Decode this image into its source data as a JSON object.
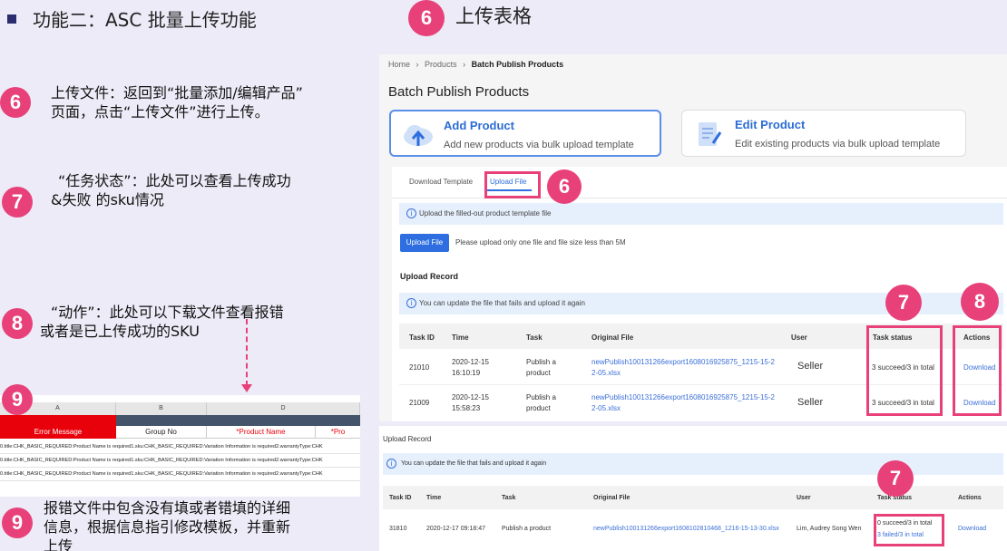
{
  "left": {
    "heading": "功能二：ASC 批量上传功能",
    "steps": [
      {
        "num": "6",
        "text_line1": "上传文件：返回到“批量添加/编辑产品”",
        "text_line2": "页面，点击“上传文件”进行上传。"
      },
      {
        "num": "7",
        "text_line1": "“任务状态”：此处可以查看上传成功",
        "text_line2": "&失败 的sku情况"
      },
      {
        "num": "8",
        "text_line1": "“动作”：此处可以下载文件查看报错",
        "text_line2": "或者是已上传成功的SKU"
      },
      {
        "num": "9",
        "text_line1": "报错文件中包含没有填或者错填的详细",
        "text_line2": "信息，根据信息指引修改模板，并重新",
        "text_line3": "上传"
      }
    ],
    "excel": {
      "badge": "9",
      "columns": [
        "A",
        "B",
        "D"
      ],
      "headers": [
        "Error Message",
        "Group No",
        "*Product Name",
        "*Pro"
      ],
      "rows": [
        "0.title:CHK_BASIC_REQUIRED:Product Name is required1.sku:CHK_BASIC_REQUIRED:Variation Information is required2.warrantyType:CHK",
        "0.title:CHK_BASIC_REQUIRED:Product Name is required1.sku:CHK_BASIC_REQUIRED:Variation Information is required2.warrantyType:CHK",
        "0.title:CHK_BASIC_REQUIRED:Product Name is required1.sku:CHK_BASIC_REQUIRED:Variation Information is required2.warrantyType:CHK"
      ],
      "accent": "#e8000b"
    }
  },
  "top": {
    "badge": "6",
    "title": "上传表格"
  },
  "shot": {
    "breadcrumb": {
      "home": "Home",
      "products": "Products",
      "current": "Batch Publish Products"
    },
    "page_title": "Batch Publish Products",
    "cards": [
      {
        "title": "Add Product",
        "desc": "Add new products via bulk upload template",
        "icon": "cloud-upload-icon"
      },
      {
        "title": "Edit Product",
        "desc": "Edit existing products via bulk upload template",
        "icon": "document-edit-icon"
      }
    ],
    "tabs": [
      "Download Template",
      "Upload File"
    ],
    "tab_badge": "6",
    "info1": "Upload the filled-out product template file",
    "upload_button": "Upload File",
    "upload_hint": "Please upload only one file and file size less than 5M",
    "upload_record": "Upload Record",
    "info2": "You can update the file that fails and upload it again",
    "badges": {
      "task_status": "7",
      "actions": "8"
    },
    "columns": [
      "Task ID",
      "Time",
      "Task",
      "Original File",
      "User",
      "Task status",
      "Actions"
    ],
    "rows": [
      {
        "id": "21010",
        "time1": "2020-12-15",
        "time2": "16:10:19",
        "task1": "Publish a",
        "task2": "product",
        "file1": "newPublish100131266export1608016925875_1215-15-2",
        "file2": "2-05.xlsx",
        "user": "Seller",
        "status": "3 succeed/3 in total",
        "action": "Download"
      },
      {
        "id": "21009",
        "time1": "2020-12-15",
        "time2": "15:58:23",
        "task1": "Publish a",
        "task2": "product",
        "file1": "newPublish100131266export1608016925875_1215-15-2",
        "file2": "2-05.xlsx",
        "user": "Seller",
        "status": "3 succeed/3 in total",
        "action": "Download"
      }
    ]
  },
  "shot2": {
    "title": "Upload Record",
    "info": "You can update the file that fails and upload it again",
    "badge": "7",
    "columns": [
      "Task ID",
      "Time",
      "Task",
      "Original File",
      "User",
      "Task status",
      "Actions"
    ],
    "row": {
      "id": "31810",
      "time": "2020-12-17 09:18:47",
      "task": "Publish a product",
      "file": "newPublish100131266export1608102810468_1216-15-13-30.xlsx",
      "user": "Lim, Audrey Song Wen",
      "status1": "0 succeed/3 in total",
      "status2": "3 failed/3 in total",
      "action": "Download"
    }
  }
}
